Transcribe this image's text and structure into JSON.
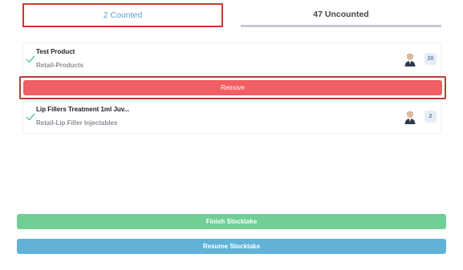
{
  "tabs": {
    "counted_label": "2 Counted",
    "uncounted_label": "47 Uncounted"
  },
  "items": [
    {
      "name": "Test Product",
      "category": "Retail-Products",
      "count": "20",
      "icon": "checkmark-icon"
    },
    {
      "name": "Lip Fillers Treatment 1ml Juv...",
      "category": "Retail-Lip Filler Injectables",
      "count": "2",
      "icon": "checkmark-icon"
    }
  ],
  "remove_label": "Remove",
  "actions": {
    "finish_label": "Finish Stocktake",
    "resume_label": "Resume Stocktake"
  },
  "colors": {
    "accent_blue": "#5b9fcf",
    "highlight_red": "#cc3a2e",
    "remove": "#f25e63",
    "finish": "#6fcf97",
    "resume": "#62b2d8",
    "check": "#5fc7a0"
  }
}
